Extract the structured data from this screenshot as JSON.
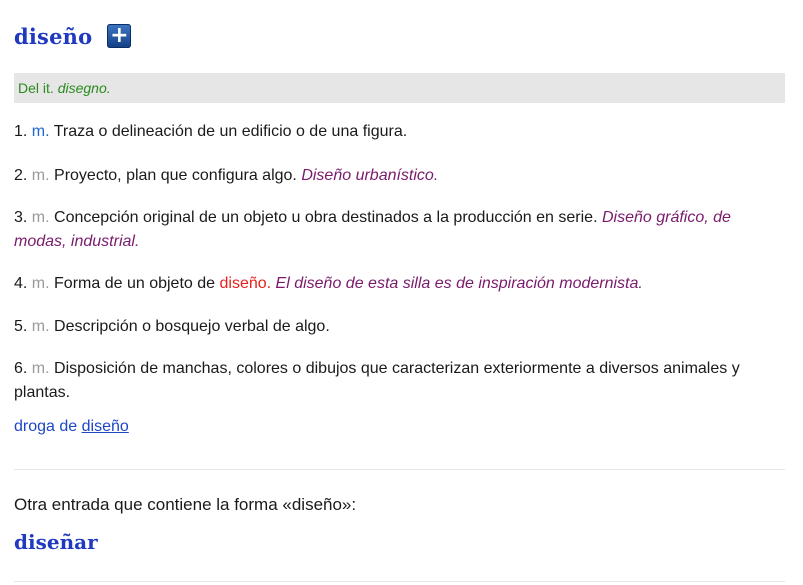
{
  "entry": {
    "headword": "diseño",
    "add_icon": "plus-icon",
    "add_label": "+"
  },
  "etymology": {
    "prefix": "Del it.",
    "word": "disegno."
  },
  "senses": [
    {
      "num": "1.",
      "abbr": "m.",
      "def": "Traza o delineación de un edificio o de una figura."
    },
    {
      "num": "2.",
      "abbr": "m.",
      "def": "Proyecto, plan que configura algo.",
      "example": "Diseño urbanístico."
    },
    {
      "num": "3.",
      "abbr": "m.",
      "def": "Concepción original de un objeto u obra destinados a la producción en serie.",
      "example": "Diseño gráfico, de modas, industrial."
    },
    {
      "num": "4.",
      "abbr": "m.",
      "def_before": "Forma de un objeto de",
      "def_highlight": "diseño.",
      "example": "El diseño de esta silla es de inspiración modernista."
    },
    {
      "num": "5.",
      "abbr": "m.",
      "def": "Descripción o bosquejo verbal de algo."
    },
    {
      "num": "6.",
      "abbr": "m.",
      "def": "Disposición de manchas, colores o dibujos que caracterizan exteriormente a diversos animales y plantas."
    }
  ],
  "related": {
    "prefix": "droga de",
    "link": "diseño"
  },
  "other_entries": {
    "heading": "Otra entrada que contiene la forma «diseño»:",
    "items": [
      "diseñar"
    ]
  },
  "colors": {
    "headword": "#1f3ac0",
    "etymology": "#2a8a1e",
    "example": "#7a1a6c",
    "highlight": "#e8201c",
    "link": "#1d46c6"
  }
}
